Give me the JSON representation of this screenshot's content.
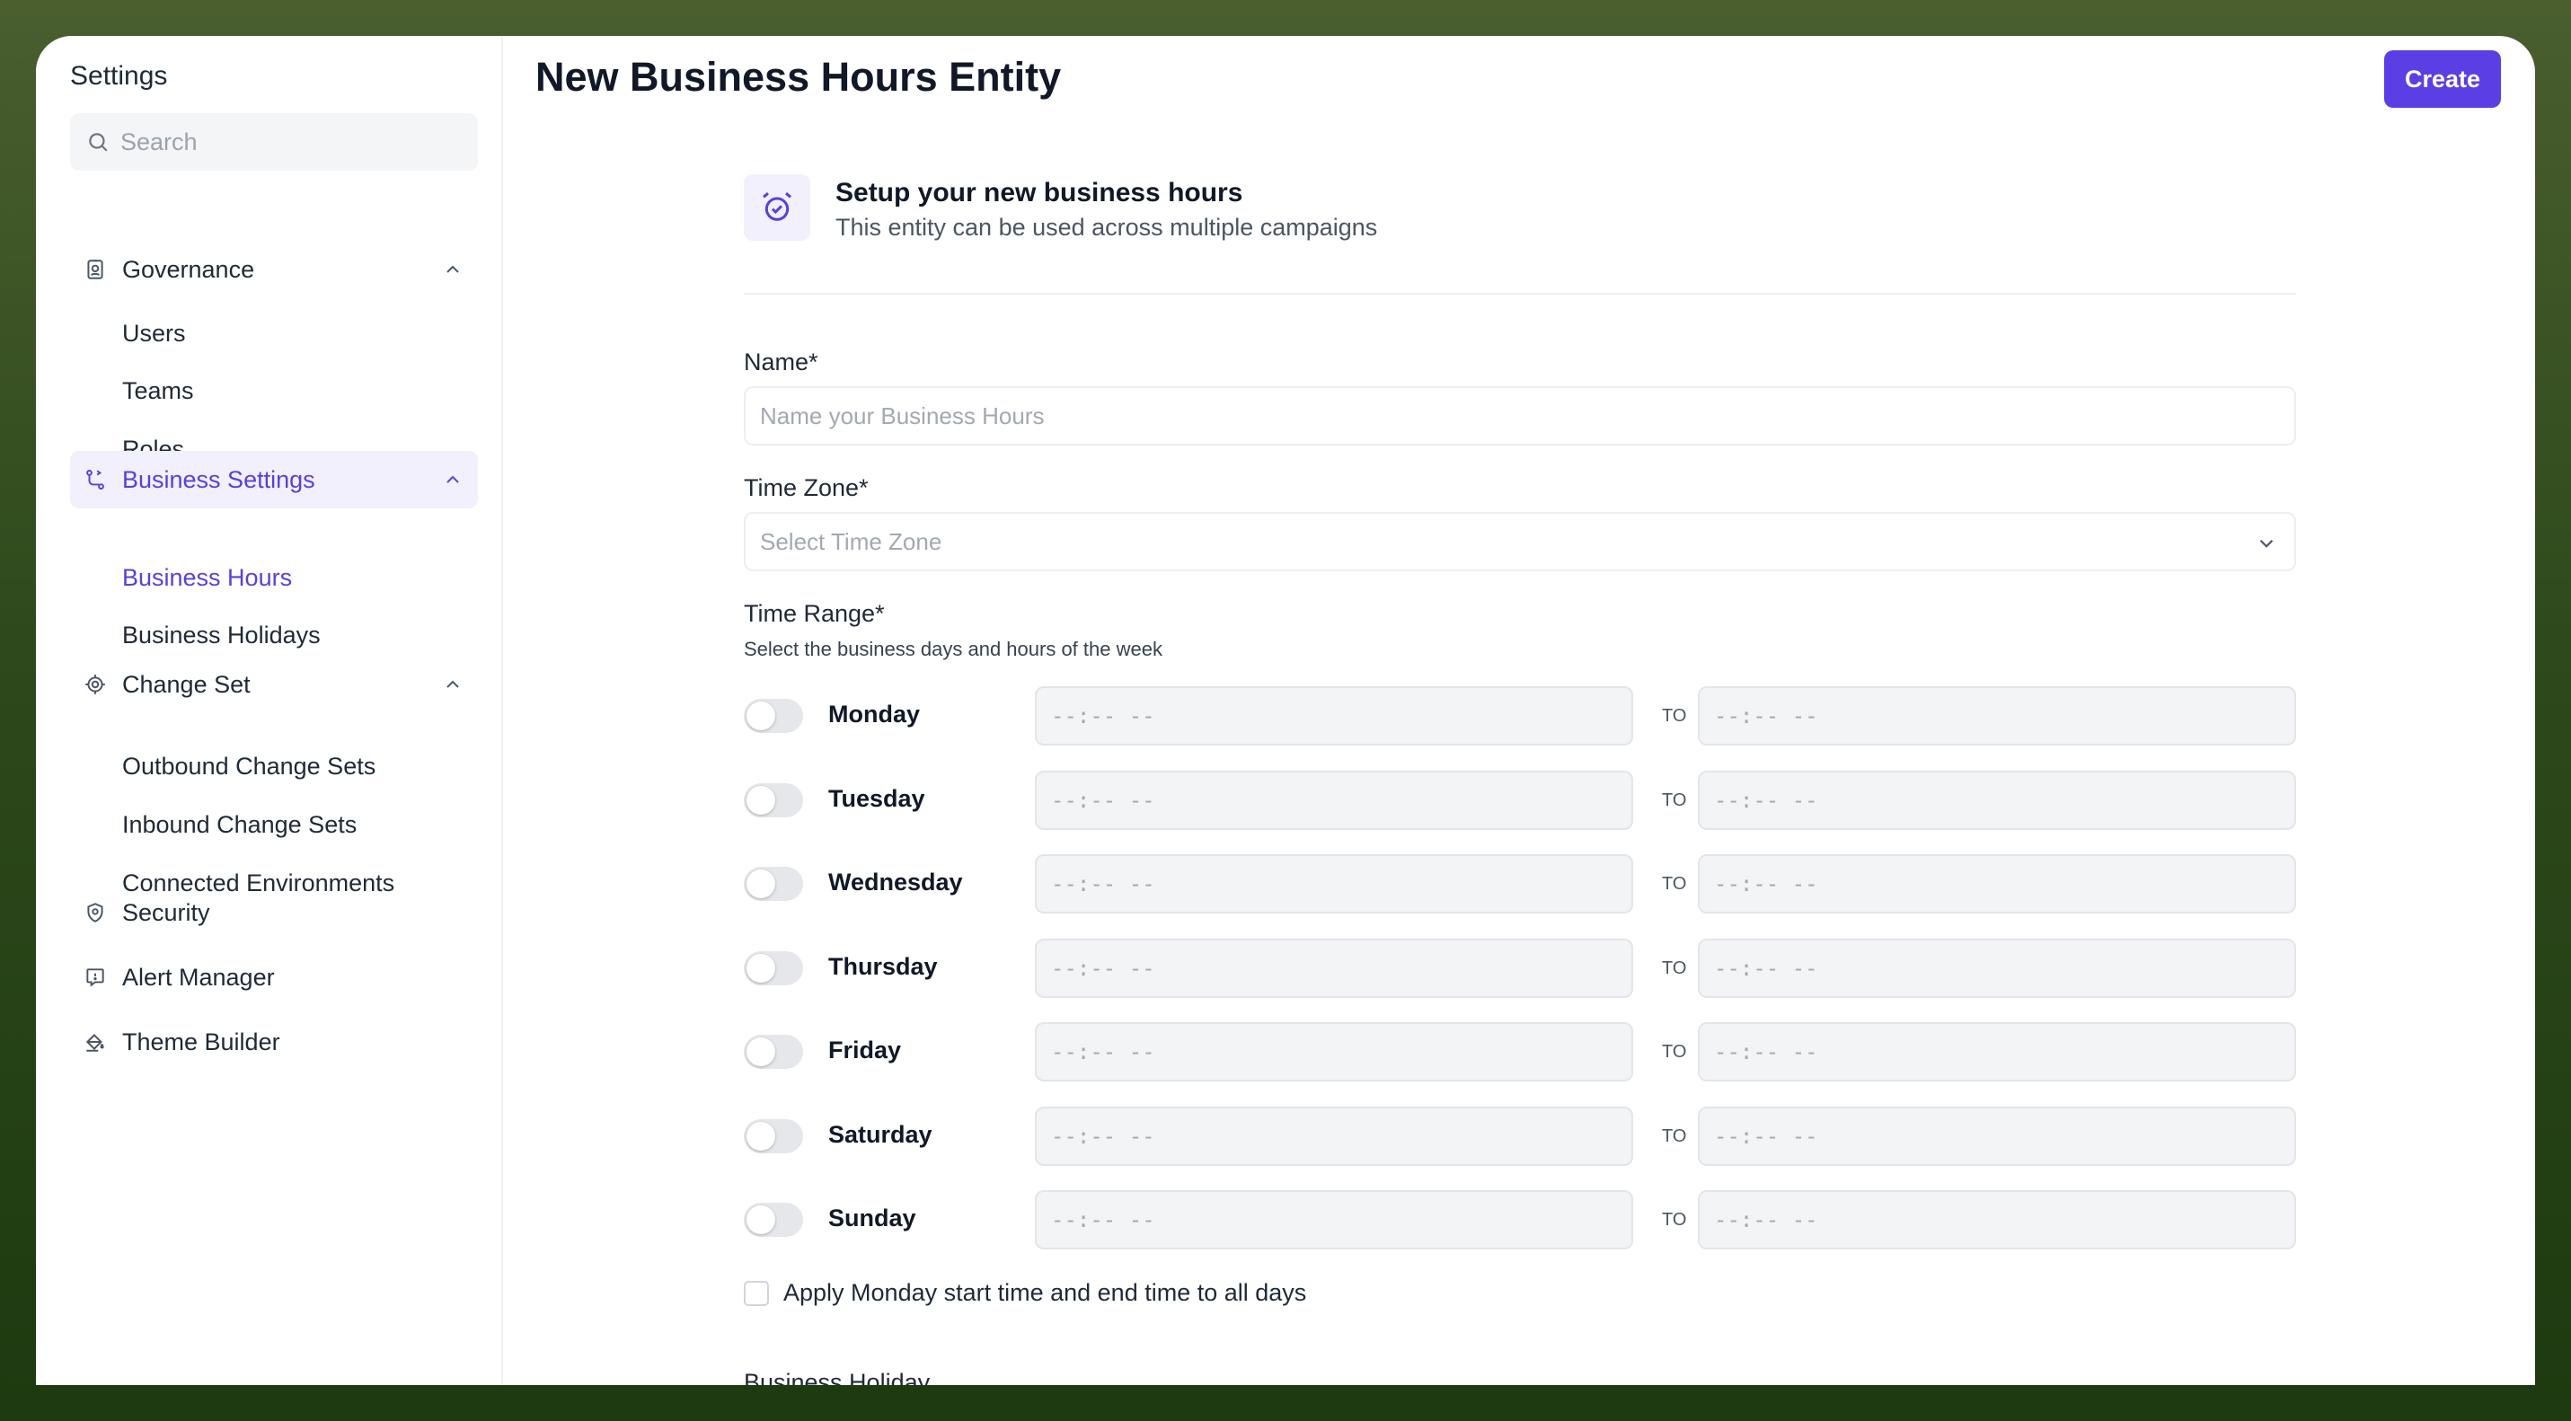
{
  "sidebar": {
    "title": "Settings",
    "search_placeholder": "Search",
    "groups": {
      "governance": {
        "label": "Governance",
        "items": [
          "Users",
          "Teams",
          "Roles"
        ]
      },
      "business_settings": {
        "label": "Business Settings",
        "items": [
          "Business Hours",
          "Business Holidays"
        ],
        "active_item": "Business Hours"
      },
      "change_set": {
        "label": "Change Set",
        "items": [
          "Outbound Change Sets",
          "Inbound Change Sets",
          "Connected Environments"
        ]
      }
    },
    "links": [
      "Security",
      "Alert Manager",
      "Theme Builder"
    ]
  },
  "header": {
    "title": "New Business Hours Entity",
    "create_label": "Create"
  },
  "setup": {
    "title": "Setup your new business hours",
    "subtitle": "This entity can be used across multiple campaigns"
  },
  "form": {
    "name_label": "Name*",
    "name_placeholder": "Name your Business Hours",
    "name_value": "",
    "timezone_label": "Time Zone*",
    "timezone_placeholder": "Select Time Zone",
    "time_range_label": "Time Range*",
    "time_range_hint": "Select the business days and hours of the week",
    "time_placeholder": "--:-- --",
    "to_label": "TO",
    "days": [
      {
        "name": "Monday",
        "enabled": false
      },
      {
        "name": "Tuesday",
        "enabled": false
      },
      {
        "name": "Wednesday",
        "enabled": false
      },
      {
        "name": "Thursday",
        "enabled": false
      },
      {
        "name": "Friday",
        "enabled": false
      },
      {
        "name": "Saturday",
        "enabled": false
      },
      {
        "name": "Sunday",
        "enabled": false
      }
    ],
    "apply_all_label": "Apply Monday start time and end time to all days",
    "apply_all_checked": false,
    "business_holiday_label": "Business Holiday"
  },
  "colors": {
    "accent": "#5b3fe4",
    "active_bg": "#f1f0fc",
    "background_top": "#4a5e2e",
    "background_bottom": "#1d3a10"
  }
}
